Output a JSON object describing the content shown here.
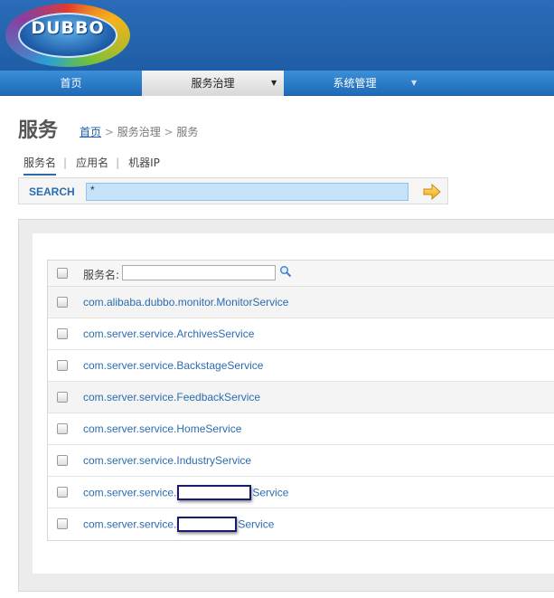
{
  "logo": {
    "text": "DUBBO"
  },
  "nav": {
    "items": [
      {
        "label": "首页",
        "arrow": ""
      },
      {
        "label": "服务治理",
        "arrow": "▼"
      },
      {
        "label": "系统管理",
        "arrow": "▼"
      }
    ]
  },
  "page": {
    "title": "服务",
    "breadcrumb": {
      "home": "首页",
      "sep1": " > ",
      "mid": "服务治理",
      "sep2": " > ",
      "current": "服务"
    }
  },
  "search_tabs": {
    "items": [
      {
        "label": "服务名",
        "active": true
      },
      {
        "label": "应用名",
        "active": false
      },
      {
        "label": "机器IP",
        "active": false
      }
    ],
    "divider": "|"
  },
  "search": {
    "label": "SEARCH",
    "value": "*"
  },
  "table": {
    "header_label": "服务名:",
    "filter_value": "",
    "rows": [
      {
        "text": "com.alibaba.dubbo.monitor.MonitorService"
      },
      {
        "text": "com.server.service.ArchivesService"
      },
      {
        "text": "com.server.service.BackstageService"
      },
      {
        "text": "com.server.service.FeedbackService"
      },
      {
        "text": "com.server.service.HomeService"
      },
      {
        "text": "com.server.service.IndustryService"
      },
      {
        "prefix": "com.server.service.",
        "suffix": "Service",
        "redacted": true
      },
      {
        "prefix": "com.server.service.",
        "suffix": "Service",
        "redacted": true
      }
    ]
  },
  "colors": {
    "header_bg": "#1f5ea6",
    "link": "#2b6cb0",
    "search_input_bg": "#c4e3f8"
  }
}
